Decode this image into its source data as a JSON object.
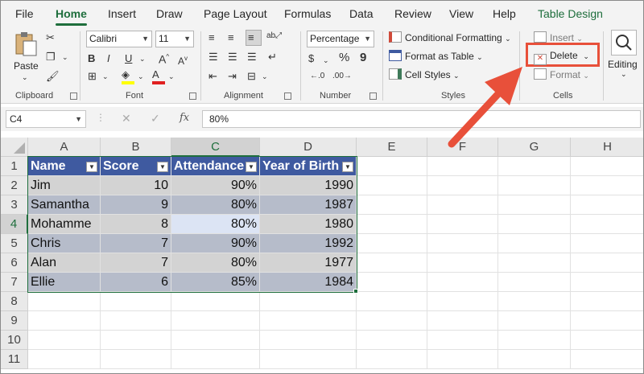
{
  "tabs": [
    "File",
    "Home",
    "Insert",
    "Draw",
    "Page Layout",
    "Formulas",
    "Data",
    "Review",
    "View",
    "Help",
    "Table Design"
  ],
  "ribbon": {
    "clipboard": {
      "paste_label": "Paste",
      "group_label": "Clipboard"
    },
    "font": {
      "family": "Calibri",
      "size": "11",
      "group_label": "Font",
      "bold": "B",
      "italic": "I",
      "underline": "U"
    },
    "alignment": {
      "group_label": "Alignment"
    },
    "number": {
      "format": "Percentage",
      "group_label": "Number",
      "percent": "%",
      "comma": "9"
    },
    "styles": {
      "conditional": "Conditional Formatting",
      "format_table": "Format as Table",
      "cell_styles": "Cell Styles",
      "group_label": "Styles"
    },
    "cells": {
      "insert": "Insert",
      "delete": "Delete",
      "format": "Format",
      "group_label": "Cells"
    },
    "editing": {
      "label": "Editing"
    }
  },
  "formula_bar": {
    "name_box": "C4",
    "fx": "fx",
    "value": "80%"
  },
  "columns": [
    "A",
    "B",
    "C",
    "D",
    "E",
    "F",
    "G",
    "H"
  ],
  "rows": [
    "1",
    "2",
    "3",
    "4",
    "5",
    "6",
    "7",
    "8",
    "9",
    "10",
    "11"
  ],
  "table": {
    "headers": [
      "Name",
      "Score",
      "Attendance",
      "Year of Birth"
    ],
    "rows": [
      [
        "Jim",
        "10",
        "90%",
        "1990"
      ],
      [
        "Samantha",
        "9",
        "80%",
        "1987"
      ],
      [
        "Mohamme",
        "8",
        "80%",
        "1980"
      ],
      [
        "Chris",
        "7",
        "90%",
        "1992"
      ],
      [
        "Alan",
        "7",
        "80%",
        "1977"
      ],
      [
        "Ellie",
        "6",
        "85%",
        "1984"
      ]
    ]
  },
  "colors": {
    "accent_green": "#1e6e3c",
    "table_header": "#3f5aa0",
    "highlight_box": "#e8503a"
  }
}
